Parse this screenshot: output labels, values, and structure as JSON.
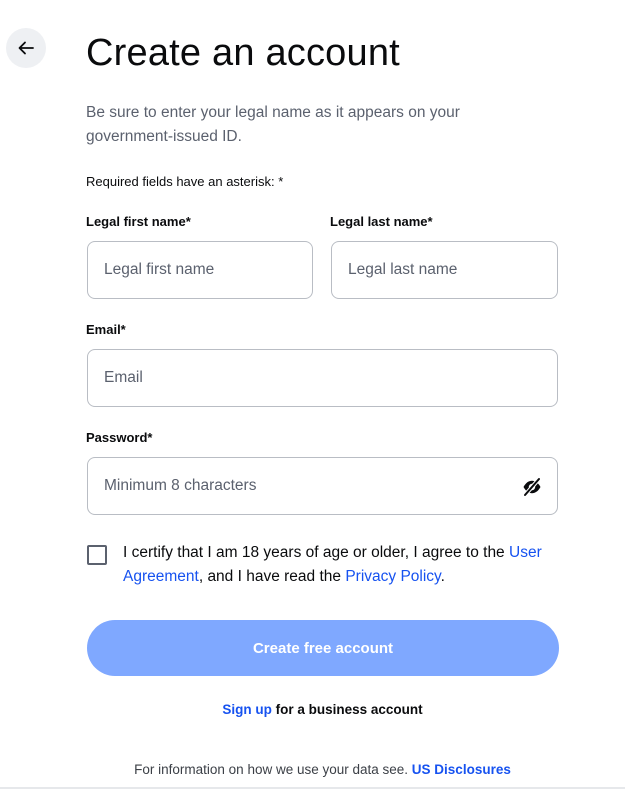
{
  "header": {
    "back_icon": "arrow-left-icon",
    "title": "Create an account",
    "subtitle": "Be sure to enter your legal name as it appears on your government-issued ID.",
    "required_note": "Required fields have an asterisk: *"
  },
  "form": {
    "first_name": {
      "label": "Legal first name*",
      "placeholder": "Legal first name",
      "value": ""
    },
    "last_name": {
      "label": "Legal last name*",
      "placeholder": "Legal last name",
      "value": ""
    },
    "email": {
      "label": "Email*",
      "placeholder": "Email",
      "value": ""
    },
    "password": {
      "label": "Password*",
      "placeholder": "Minimum 8 characters",
      "value": "",
      "toggle_icon": "eye-slash-icon"
    },
    "certify": {
      "checked": false,
      "text_before": "I certify that I am 18 years of age or older, I agree to the ",
      "user_agreement_link": "User Agreement",
      "text_middle": ", and I have read the ",
      "privacy_policy_link": "Privacy Policy",
      "text_after": "."
    },
    "submit_label": "Create free account"
  },
  "footer": {
    "signup_link": "Sign up",
    "signup_suffix": " for a business account",
    "info_text": "For information on how we use your data see. ",
    "disclosures_link": "US Disclosures"
  },
  "colors": {
    "accent": "#1652f0",
    "button_disabled": "#7fa8ff",
    "muted_text": "#5b616e",
    "border": "#b9bdc4"
  }
}
